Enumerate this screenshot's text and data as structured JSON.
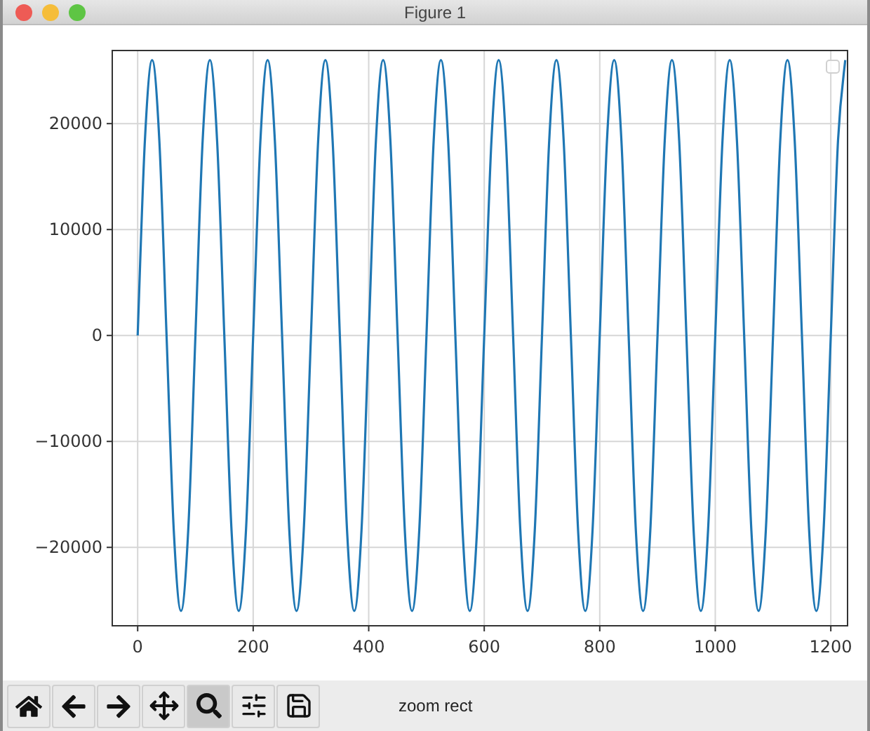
{
  "window": {
    "title": "Figure 1"
  },
  "plot": {
    "legend": {
      "shown": true
    },
    "chart_data": {
      "type": "line",
      "grid": true,
      "xlim": [
        -44,
        1229
      ],
      "ylim": [
        -27400,
        26900
      ],
      "xticks": [
        0,
        200,
        400,
        600,
        800,
        1000,
        1200
      ],
      "yticks": [
        {
          "value": -20000,
          "label": "−20000"
        },
        {
          "value": -10000,
          "label": "−10000"
        },
        {
          "value": 0,
          "label": "0"
        },
        {
          "value": 10000,
          "label": "10000"
        },
        {
          "value": 20000,
          "label": "20000"
        }
      ],
      "x": [
        0,
        12.5,
        25,
        37.5,
        50,
        62.5,
        75,
        87.5,
        100,
        112.5,
        125,
        137.5,
        150,
        162.5,
        175,
        187.5,
        200,
        212.5,
        225,
        237.5,
        250,
        262.5,
        275,
        287.5,
        300,
        312.5,
        325,
        337.5,
        350,
        362.5,
        375,
        387.5,
        400,
        412.5,
        425,
        437.5,
        450,
        462.5,
        475,
        487.5,
        500,
        512.5,
        525,
        537.5,
        550,
        562.5,
        575,
        587.5,
        600,
        612.5,
        625,
        637.5,
        650,
        662.5,
        675,
        687.5,
        700,
        712.5,
        725,
        737.5,
        750,
        762.5,
        775,
        787.5,
        800,
        812.5,
        825,
        837.5,
        850,
        862.5,
        875,
        887.5,
        900,
        912.5,
        925,
        937.5,
        950,
        962.5,
        975,
        987.5,
        1000,
        1012.5,
        1025,
        1037.5,
        1050,
        1062.5,
        1075,
        1087.5,
        1100,
        1112.5,
        1125,
        1137.5,
        1150,
        1162.5,
        1175,
        1187.5,
        1200,
        1212.5,
        1225
      ],
      "series": [
        {
          "color": "#1f77b4",
          "values": [
            0,
            18400,
            26000,
            18400,
            0,
            -18400,
            -26000,
            -18400,
            0,
            18400,
            26000,
            18400,
            0,
            -18400,
            -26000,
            -18400,
            0,
            18400,
            26000,
            18400,
            0,
            -18400,
            -26000,
            -18400,
            0,
            18400,
            26000,
            18400,
            0,
            -18400,
            -26000,
            -18400,
            0,
            18400,
            26000,
            18400,
            0,
            -18400,
            -26000,
            -18400,
            0,
            18400,
            26000,
            18400,
            0,
            -18400,
            -26000,
            -18400,
            0,
            18400,
            26000,
            18400,
            0,
            -18400,
            -26000,
            -18400,
            0,
            18400,
            26000,
            18400,
            0,
            -18400,
            -26000,
            -18400,
            0,
            18400,
            26000,
            18400,
            0,
            -18400,
            -26000,
            -18400,
            0,
            18400,
            26000,
            18400,
            0,
            -18400,
            -26000,
            -18400,
            0,
            18400,
            26000,
            18400,
            0,
            -18400,
            -26000,
            -18400,
            0,
            18400,
            26000,
            18400,
            0,
            -18400,
            -26000,
            -18400,
            0,
            18400,
            26000
          ]
        }
      ]
    }
  },
  "toolbar": {
    "buttons": [
      {
        "kind": "home",
        "selected": false
      },
      {
        "kind": "back",
        "selected": false
      },
      {
        "kind": "forward",
        "selected": false
      },
      {
        "kind": "pan",
        "selected": false
      },
      {
        "kind": "zoom",
        "selected": true
      },
      {
        "kind": "configure",
        "selected": false
      },
      {
        "kind": "save",
        "selected": false
      }
    ],
    "message": "zoom rect"
  }
}
